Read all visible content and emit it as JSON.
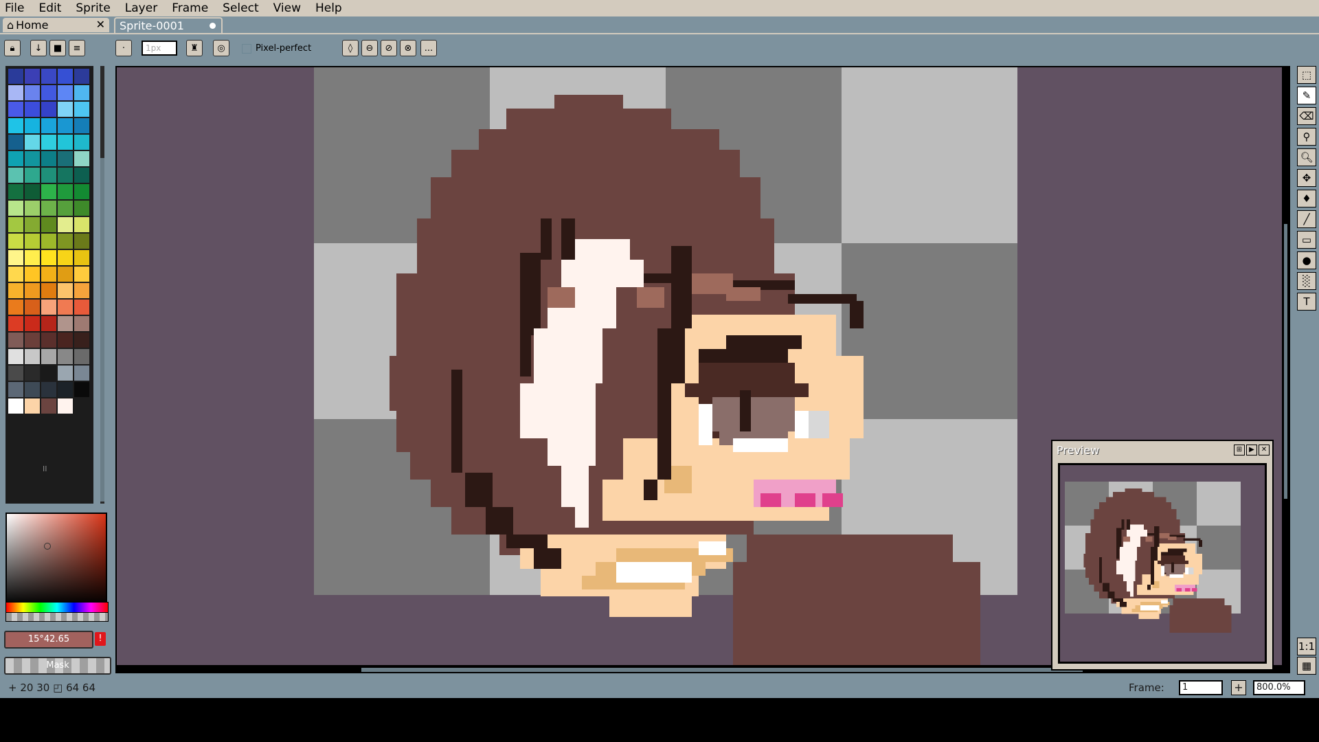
{
  "menu": [
    "File",
    "Edit",
    "Sprite",
    "Layer",
    "Frame",
    "Select",
    "View",
    "Help"
  ],
  "tabs": {
    "home_label": "Home",
    "home_close": "✕",
    "sprite_label": "Sprite-0001"
  },
  "context_bar": {
    "brush_size_placeholder": "1px",
    "pixel_perfect_label": "Pixel-perfect",
    "more_label": "..."
  },
  "color": {
    "readout": "15°42.65",
    "warning": "!",
    "mask_label": "Mask",
    "overflow_marker": "II"
  },
  "palette": [
    "#2a3b9a",
    "#3b3fb5",
    "#3a48c4",
    "#3650d4",
    "#2c3b9a",
    "#a8b7f5",
    "#6a83ee",
    "#4259e0",
    "#5d86f5",
    "#4fb6f0",
    "#4a5ae8",
    "#3c4ddc",
    "#3542c8",
    "#7fd3f6",
    "#4ec6f2",
    "#1fc3e7",
    "#16b3e0",
    "#1aa5dc",
    "#1a97d2",
    "#157eb8",
    "#15608e",
    "#64d7e8",
    "#2fcfe0",
    "#22c5d9",
    "#1fb8cc",
    "#0fa2b2",
    "#12959e",
    "#0d7f88",
    "#1a6f78",
    "#8fd5c5",
    "#5bc2b0",
    "#2ea88e",
    "#1f907a",
    "#157560",
    "#0d5f50",
    "#147040",
    "#0f5c36",
    "#2db34a",
    "#1f9a3c",
    "#138a32",
    "#b8e68b",
    "#9ccf6a",
    "#6db34a",
    "#56a03c",
    "#3e8a2a",
    "#a3c841",
    "#84aa31",
    "#5f8a1f",
    "#e3ed8e",
    "#d9e36a",
    "#cadc45",
    "#b6cc34",
    "#9db82a",
    "#7f9622",
    "#6b7a1a",
    "#fff58a",
    "#ffee4d",
    "#ffe21f",
    "#f7d418",
    "#e8c312",
    "#ffd84d",
    "#ffc524",
    "#f2b018",
    "#e09d14",
    "#ffcb3d",
    "#f7b22c",
    "#ee9a1f",
    "#e07c10",
    "#fcc36b",
    "#f5a33c",
    "#ea7b1c",
    "#d8601a",
    "#f8a37a",
    "#f07a52",
    "#e85a3a",
    "#dc3c24",
    "#ca2a1a",
    "#b5251a",
    "#b0948c",
    "#9e7a72",
    "#805c58",
    "#6b3f3a",
    "#5a2f2c",
    "#4a2420",
    "#38201c",
    "#e0e0e0",
    "#c8c8c8",
    "#a8a8a8",
    "#888888",
    "#6a6a6a",
    "#4a4a4a",
    "#2a2a2a",
    "#1a1a1a",
    "#9aa6b0",
    "#7a8794",
    "#5c6876",
    "#3e4a56",
    "#2a323c",
    "#1c2228",
    "#0a0a0a",
    "#ffffff",
    "#fcd4a8",
    "#6b4440",
    "#fff3ee"
  ],
  "tools": [
    "marquee",
    "pencil",
    "eraser",
    "eyedropper",
    "zoom",
    "move",
    "fill",
    "line",
    "rectangle",
    "ellipse",
    "blur",
    "text"
  ],
  "preview": {
    "title": "Preview"
  },
  "status": {
    "position": "20 30",
    "size": "64 64",
    "frame_label": "Frame:",
    "frame_value": "1",
    "zoom_value": "800.0%"
  }
}
